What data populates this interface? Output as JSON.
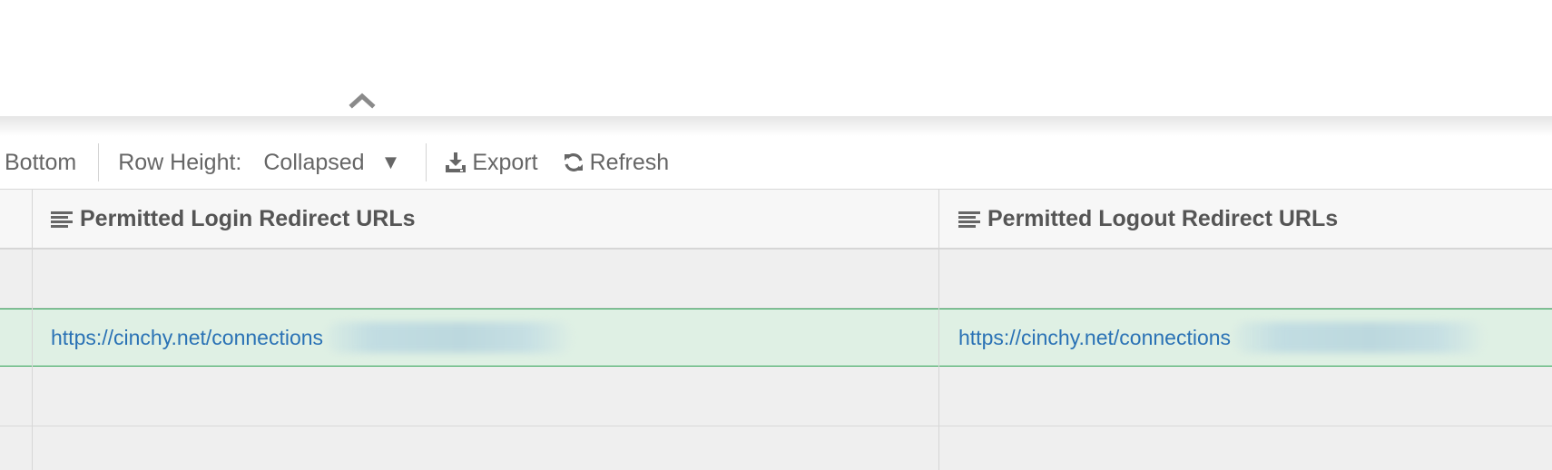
{
  "toolbar": {
    "bottom_label": "Bottom",
    "row_height_label": "Row Height:",
    "row_height_value": "Collapsed",
    "caret_glyph": "▼",
    "export_label": "Export",
    "refresh_label": "Refresh",
    "icons": {
      "export": "download-icon",
      "refresh": "refresh-icon"
    }
  },
  "panel": {
    "toggle_icon": "chevron-up-icon"
  },
  "grid": {
    "columns": [
      {
        "label": "Permitted Login Redirect URLs",
        "icon": "text-column-icon"
      },
      {
        "label": "Permitted Logout Redirect URLs",
        "icon": "text-column-icon"
      }
    ],
    "rows": [
      {
        "login_url": "",
        "logout_url": ""
      },
      {
        "login_url": "https://cinchy.net/connections",
        "logout_url": "https://cinchy.net/connections",
        "selected": true
      },
      {
        "login_url": "",
        "logout_url": ""
      },
      {
        "login_url": "",
        "logout_url": ""
      }
    ]
  },
  "colors": {
    "toolbar_text": "#666666",
    "header_text": "#555555",
    "link": "#2a72b5",
    "selected_row_bg": "#dff0e4",
    "selected_row_border": "#2aa152",
    "grid_bg": "#efefef",
    "header_bg": "#f7f7f7"
  }
}
